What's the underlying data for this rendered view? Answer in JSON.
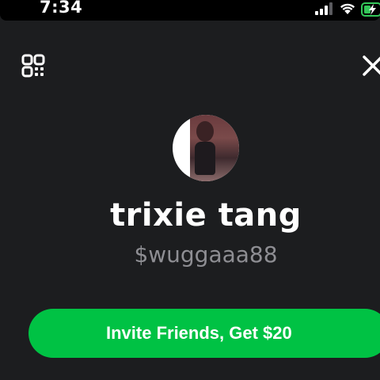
{
  "status_bar": {
    "time": "7:34",
    "icons": [
      "cellular-signal-icon",
      "wifi-icon",
      "battery-charging-icon"
    ]
  },
  "header": {
    "left_icon": "qr-code-icon",
    "right_icon": "close-icon"
  },
  "profile": {
    "display_name": "trixie tang",
    "cashtag": "$wuggaaa88"
  },
  "actions": {
    "invite_label": "Invite Friends, Get $20"
  },
  "colors": {
    "background": "#1c1d1f",
    "primary_button": "#00c244",
    "secondary_text": "#8e8e93",
    "battery_charge": "#34c759"
  }
}
